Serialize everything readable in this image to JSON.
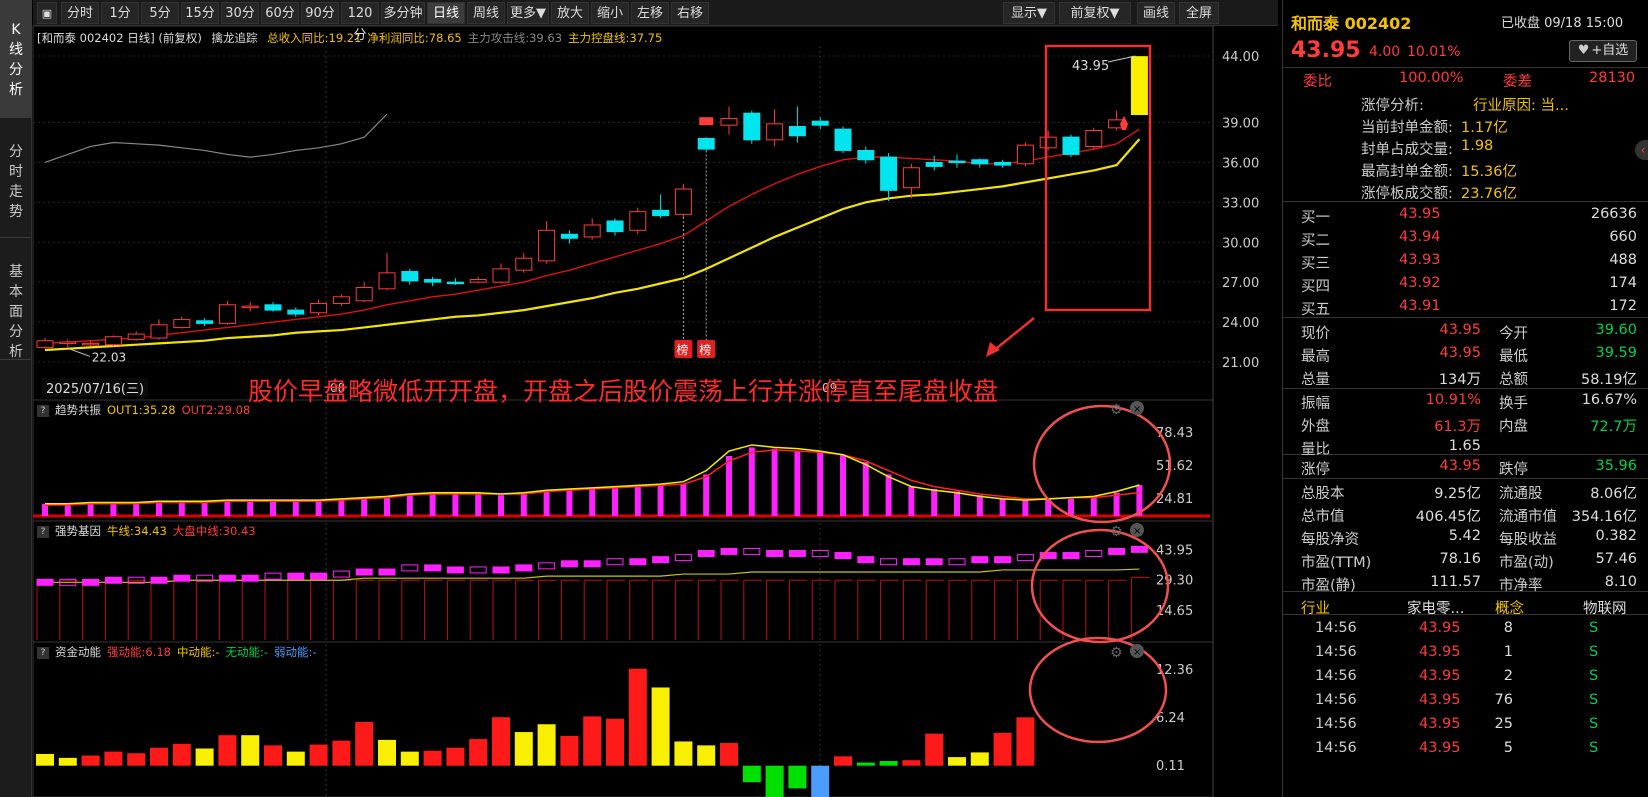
{
  "side_tabs": [
    "K线分析",
    "分时走势",
    "基本面分析"
  ],
  "toolbar": {
    "items": [
      "分时",
      "1分",
      "5分",
      "15分",
      "30分",
      "60分",
      "90分",
      "120分",
      "多分钟",
      "日线",
      "周线",
      "更多▼",
      "放大",
      "缩小",
      "左移",
      "右移"
    ],
    "right_items": [
      "显示▼",
      "前复权▼",
      "画线",
      "全屏"
    ],
    "active": "日线"
  },
  "main_chart": {
    "title": "[和而泰 002402 日线] (前复权)",
    "indicator_name": "擒龙追踪",
    "metrics": [
      {
        "text": "总收入同比:19.21",
        "color": "#f2c200"
      },
      {
        "text": "净利润同比:78.65",
        "color": "#f2c200"
      },
      {
        "text": "主力攻击线:39.63",
        "color": "#888"
      },
      {
        "text": "主力控盘线:37.75",
        "color": "#f2c200"
      }
    ],
    "y_ticks": [
      "44.00",
      "39.00",
      "36.00",
      "33.00",
      "30.00",
      "27.00",
      "24.00",
      "21.00"
    ],
    "low_label": "22.03",
    "high_label": "43.95",
    "date_label": "2025/07/16(三)",
    "month_labels": [
      "08",
      "09"
    ],
    "bang_tags": [
      "榜",
      "榜"
    ],
    "annotation": "股价早盘略微低开开盘，开盘之后股价震荡上行并涨停直至尾盘收盘"
  },
  "sub_charts": [
    {
      "name": "趋势共振",
      "fields": [
        {
          "text": "OUT1:35.28",
          "color": "#f2c200"
        },
        {
          "text": "OUT2:29.08",
          "color": "#ff3b3b"
        }
      ],
      "y_ticks": [
        "78.43",
        "51.62",
        "24.81"
      ]
    },
    {
      "name": "强势基因",
      "fields": [
        {
          "text": "牛线:34.43",
          "color": "#f2c200"
        },
        {
          "text": "大盘中线:30.43",
          "color": "#ff3b3b"
        }
      ],
      "y_ticks": [
        "43.95",
        "29.30",
        "14.65"
      ]
    },
    {
      "name": "资金动能",
      "fields": [
        {
          "text": "强动能:6.18",
          "color": "#ff3b3b"
        },
        {
          "text": "中动能:-",
          "color": "#f2c200"
        },
        {
          "text": "无动能:-",
          "color": "#00d24a"
        },
        {
          "text": "弱动能:-",
          "color": "#4a9cff"
        }
      ],
      "y_ticks": [
        "12.36",
        "6.24",
        "0.11"
      ]
    }
  ],
  "chart_data": {
    "type": "candlestick",
    "title": "和而泰 002402 日线",
    "y_range": [
      21.0,
      44.0
    ],
    "candles": [
      {
        "o": 22.1,
        "c": 22.6,
        "h": 22.8,
        "l": 22.0
      },
      {
        "o": 22.4,
        "c": 22.5,
        "h": 22.7,
        "l": 22.03
      },
      {
        "o": 22.3,
        "c": 22.4,
        "h": 22.6,
        "l": 22.2
      },
      {
        "o": 22.3,
        "c": 22.9,
        "h": 23.0,
        "l": 22.2
      },
      {
        "o": 22.7,
        "c": 23.1,
        "h": 23.3,
        "l": 22.6
      },
      {
        "o": 22.8,
        "c": 23.8,
        "h": 24.2,
        "l": 22.7
      },
      {
        "o": 23.6,
        "c": 24.2,
        "h": 24.4,
        "l": 23.5
      },
      {
        "o": 24.1,
        "c": 23.9,
        "h": 24.3,
        "l": 23.7
      },
      {
        "o": 23.9,
        "c": 25.3,
        "h": 25.6,
        "l": 23.8
      },
      {
        "o": 25.1,
        "c": 25.2,
        "h": 25.5,
        "l": 24.8
      },
      {
        "o": 25.3,
        "c": 24.9,
        "h": 25.5,
        "l": 24.8
      },
      {
        "o": 24.9,
        "c": 24.6,
        "h": 25.1,
        "l": 24.4
      },
      {
        "o": 24.7,
        "c": 25.4,
        "h": 25.7,
        "l": 24.5
      },
      {
        "o": 25.4,
        "c": 25.9,
        "h": 26.1,
        "l": 25.2
      },
      {
        "o": 25.6,
        "c": 26.6,
        "h": 27.0,
        "l": 25.5
      },
      {
        "o": 26.5,
        "c": 27.7,
        "h": 29.2,
        "l": 26.4
      },
      {
        "o": 27.8,
        "c": 27.1,
        "h": 28.0,
        "l": 26.8
      },
      {
        "o": 27.2,
        "c": 27.0,
        "h": 27.4,
        "l": 26.7
      },
      {
        "o": 27.0,
        "c": 26.9,
        "h": 27.3,
        "l": 26.8
      },
      {
        "o": 27.0,
        "c": 27.2,
        "h": 27.4,
        "l": 26.9
      },
      {
        "o": 27.0,
        "c": 28.0,
        "h": 28.4,
        "l": 26.9
      },
      {
        "o": 27.9,
        "c": 28.8,
        "h": 29.2,
        "l": 27.7
      },
      {
        "o": 28.6,
        "c": 30.9,
        "h": 31.6,
        "l": 28.4
      },
      {
        "o": 30.6,
        "c": 30.3,
        "h": 30.9,
        "l": 29.9
      },
      {
        "o": 30.4,
        "c": 31.3,
        "h": 31.8,
        "l": 30.2
      },
      {
        "o": 31.6,
        "c": 30.8,
        "h": 31.8,
        "l": 30.5
      },
      {
        "o": 30.9,
        "c": 32.3,
        "h": 32.6,
        "l": 30.6
      },
      {
        "o": 32.4,
        "c": 32.0,
        "h": 33.6,
        "l": 31.8
      },
      {
        "o": 32.1,
        "c": 34.0,
        "h": 34.4,
        "l": 31.9
      },
      {
        "o": 37.8,
        "c": 37.0,
        "h": 37.9,
        "l": 36.9
      },
      {
        "o": 38.8,
        "c": 39.3,
        "h": 40.2,
        "l": 38.1
      },
      {
        "o": 39.7,
        "c": 37.7,
        "h": 39.9,
        "l": 37.4
      },
      {
        "o": 37.7,
        "c": 38.9,
        "h": 40.0,
        "l": 37.2
      },
      {
        "o": 38.7,
        "c": 38.0,
        "h": 40.2,
        "l": 37.5
      },
      {
        "o": 39.1,
        "c": 38.8,
        "h": 39.4,
        "l": 38.5
      },
      {
        "o": 38.5,
        "c": 36.9,
        "h": 38.7,
        "l": 36.7
      },
      {
        "o": 36.9,
        "c": 36.2,
        "h": 37.2,
        "l": 35.9
      },
      {
        "o": 36.4,
        "c": 33.9,
        "h": 36.7,
        "l": 33.1
      },
      {
        "o": 34.1,
        "c": 35.6,
        "h": 35.9,
        "l": 33.3
      },
      {
        "o": 36.0,
        "c": 35.7,
        "h": 36.5,
        "l": 35.4
      },
      {
        "o": 36.1,
        "c": 36.0,
        "h": 36.6,
        "l": 35.6
      },
      {
        "o": 36.2,
        "c": 35.9,
        "h": 36.3,
        "l": 35.6
      },
      {
        "o": 36.0,
        "c": 35.8,
        "h": 36.2,
        "l": 35.6
      },
      {
        "o": 35.9,
        "c": 37.3,
        "h": 37.5,
        "l": 35.7
      },
      {
        "o": 37.1,
        "c": 37.9,
        "h": 38.4,
        "l": 36.9
      },
      {
        "o": 37.9,
        "c": 36.6,
        "h": 38.1,
        "l": 36.4
      },
      {
        "o": 37.2,
        "c": 38.4,
        "h": 38.6,
        "l": 37.0
      },
      {
        "o": 38.6,
        "c": 39.2,
        "h": 39.9,
        "l": 38.4
      },
      {
        "o": 39.6,
        "c": 43.95,
        "h": 43.95,
        "l": 39.59
      }
    ],
    "ma_gray": [
      22.5,
      22.6,
      22.7,
      22.8,
      23.0,
      23.2,
      23.4,
      23.6,
      23.9,
      24.1,
      24.3,
      24.5,
      24.7,
      24.9,
      25.2,
      25.6,
      26.0,
      26.3,
      26.5,
      26.7,
      27.0,
      27.4,
      27.9,
      28.3,
      28.8,
      29.3,
      29.8,
      30.3,
      30.9,
      32.1,
      33.4,
      34.4,
      35.3,
      36.0,
      36.6,
      37.2,
      37.5,
      37.4,
      37.3,
      37.1,
      36.9,
      36.6,
      36.4,
      36.6,
      36.9,
      37.1,
      37.4,
      37.9,
      39.63
    ],
    "ma_red": [
      22.4,
      22.5,
      22.6,
      22.7,
      22.8,
      23.0,
      23.2,
      23.4,
      23.6,
      23.8,
      24.0,
      24.2,
      24.4,
      24.6,
      24.9,
      25.3,
      25.6,
      25.9,
      26.1,
      26.4,
      26.7,
      27.0,
      27.5,
      27.9,
      28.4,
      28.9,
      29.4,
      29.9,
      30.5,
      31.6,
      32.7,
      33.6,
      34.4,
      35.1,
      35.7,
      36.2,
      36.4,
      36.4,
      36.3,
      36.2,
      36.1,
      35.9,
      35.9,
      36.1,
      36.4,
      36.7,
      37.0,
      37.4,
      38.5
    ],
    "ma_yellow": [
      21.9,
      22.0,
      22.1,
      22.2,
      22.3,
      22.4,
      22.5,
      22.6,
      22.8,
      22.9,
      23.0,
      23.2,
      23.3,
      23.4,
      23.6,
      23.8,
      24.0,
      24.2,
      24.4,
      24.5,
      24.7,
      24.9,
      25.2,
      25.5,
      25.8,
      26.2,
      26.5,
      26.9,
      27.3,
      28.0,
      28.8,
      29.6,
      30.4,
      31.1,
      31.8,
      32.5,
      33.0,
      33.3,
      33.5,
      33.6,
      33.8,
      34.0,
      34.2,
      34.5,
      34.8,
      35.1,
      35.4,
      35.8,
      37.75
    ]
  },
  "trend_data": {
    "y_range": [
      10,
      90
    ],
    "bars": [
      20,
      20,
      20,
      20,
      20,
      21,
      21,
      21,
      22,
      22,
      22,
      22,
      22,
      23,
      24,
      25,
      27,
      28,
      28,
      28,
      27,
      28,
      30,
      31,
      32,
      33,
      34,
      35,
      36,
      44,
      59,
      66,
      65,
      63,
      62,
      60,
      54,
      44,
      34,
      32,
      30,
      27,
      24,
      23,
      24,
      24,
      25,
      29,
      35.28
    ],
    "out1": [
      20,
      20,
      21,
      21,
      21,
      22,
      22,
      22,
      23,
      23,
      23,
      23,
      23,
      24,
      25,
      26,
      28,
      29,
      29,
      29,
      28,
      29,
      31,
      32,
      33,
      34,
      35,
      36,
      38,
      47,
      63,
      68,
      66,
      65,
      63,
      60,
      52,
      42,
      34,
      31,
      29,
      26,
      24,
      23,
      24,
      25,
      26,
      30,
      35.28
    ],
    "out2": [
      19,
      19,
      20,
      20,
      20,
      21,
      21,
      21,
      22,
      22,
      22,
      22,
      22,
      23,
      24,
      25,
      27,
      28,
      28,
      28,
      28,
      28,
      30,
      31,
      32,
      33,
      34,
      35,
      36,
      42,
      55,
      62,
      64,
      63,
      62,
      60,
      55,
      47,
      39,
      34,
      31,
      28,
      26,
      24,
      24,
      25,
      25,
      27,
      29.08
    ]
  },
  "strong_data": {
    "y_range": [
      0,
      50
    ],
    "stems": [
      29,
      29,
      29,
      29,
      29,
      29,
      29,
      29,
      29,
      29,
      29,
      29,
      29,
      29,
      29,
      29,
      29,
      29,
      29,
      29,
      29,
      29,
      29,
      29,
      29,
      29,
      29,
      29,
      29,
      29,
      29,
      29,
      29,
      29,
      29,
      29,
      29,
      29,
      29,
      29,
      29,
      29,
      29,
      29,
      29,
      29,
      29,
      29,
      30.43
    ],
    "blocks": [
      28,
      28,
      28,
      29,
      29,
      29,
      30,
      30,
      30,
      30,
      31,
      31,
      31,
      32,
      33,
      33,
      35,
      35,
      34,
      34,
      34,
      35,
      36,
      37,
      37,
      38,
      38,
      39,
      40,
      42,
      43,
      43,
      42,
      42,
      42,
      41,
      39,
      38,
      38,
      38,
      38,
      39,
      39,
      40,
      41,
      41,
      42,
      43,
      44
    ],
    "bull": [
      28,
      28,
      28,
      28,
      28,
      28,
      29,
      29,
      29,
      29,
      29,
      29,
      29,
      29,
      30,
      30,
      30,
      30,
      30,
      30,
      30,
      30,
      31,
      31,
      31,
      31,
      31,
      31,
      32,
      32,
      32,
      33,
      33,
      33,
      33,
      33,
      33,
      33,
      33,
      33,
      33,
      33,
      34,
      34,
      34,
      34,
      34,
      34,
      34.43
    ]
  },
  "money_data": {
    "y_range": [
      -4,
      13
    ],
    "bars": [
      1.5,
      1.0,
      1.3,
      1.8,
      1.6,
      2.3,
      2.8,
      2.2,
      3.9,
      3.9,
      2.6,
      1.8,
      2.7,
      3.2,
      5.6,
      3.3,
      1.8,
      1.9,
      2.3,
      3.4,
      6.2,
      4.3,
      5.3,
      3.8,
      6.3,
      6.0,
      12.4,
      10.0,
      3.1,
      2.6,
      2.9,
      -2.1,
      -4.0,
      -2.9,
      -4.4,
      1.2,
      0.4,
      0.6,
      0.7,
      4.1,
      1.1,
      1.7,
      4.2,
      6.18
    ],
    "colors": [
      "y",
      "y",
      "r",
      "r",
      "r",
      "r",
      "r",
      "y",
      "r",
      "y",
      "r",
      "y",
      "r",
      "r",
      "r",
      "y",
      "y",
      "r",
      "r",
      "r",
      "r",
      "y",
      "y",
      "r",
      "r",
      "r",
      "r",
      "y",
      "y",
      "y",
      "r",
      "g",
      "g",
      "g",
      "b",
      "r",
      "g",
      "g",
      "r",
      "r",
      "y",
      "y",
      "r",
      "r"
    ]
  },
  "right_panel": {
    "name": "和而泰 002402",
    "status": "已收盘 09/18 15:00",
    "price": "43.95",
    "change": "4.00",
    "pct": "10.01%",
    "add_btn": "+自选",
    "weibi_label": "委比",
    "weibi_val": "100.00%",
    "weicha_label": "委差",
    "weicha_val": "28130",
    "limit_analysis": [
      {
        "label": "涨停分析:",
        "val": "行业原因: 当..."
      },
      {
        "label": "当前封单金额:",
        "val": "1.17亿"
      },
      {
        "label": "封单占成交量:",
        "val": "1.98"
      },
      {
        "label": "最高封单金额:",
        "val": "15.36亿"
      },
      {
        "label": "涨停板成交额:",
        "val": "23.76亿"
      }
    ],
    "bids": [
      {
        "label": "买一",
        "price": "43.95",
        "vol": "26636"
      },
      {
        "label": "买二",
        "price": "43.94",
        "vol": "660"
      },
      {
        "label": "买三",
        "price": "43.93",
        "vol": "488"
      },
      {
        "label": "买四",
        "price": "43.92",
        "vol": "174"
      },
      {
        "label": "买五",
        "price": "43.91",
        "vol": "172"
      }
    ],
    "stats1": [
      {
        "l1": "现价",
        "v1": "43.95",
        "c1": "r",
        "l2": "今开",
        "v2": "39.60",
        "c2": "g"
      },
      {
        "l1": "最高",
        "v1": "43.95",
        "c1": "r",
        "l2": "最低",
        "v2": "39.59",
        "c2": "g"
      },
      {
        "l1": "总量",
        "v1": "134万",
        "c1": "w",
        "l2": "总额",
        "v2": "58.19亿",
        "c2": "w"
      }
    ],
    "stats2": [
      {
        "l1": "振幅",
        "v1": "10.91%",
        "c1": "r",
        "l2": "换手",
        "v2": "16.67%",
        "c2": "w"
      },
      {
        "l1": "外盘",
        "v1": "61.3万",
        "c1": "r",
        "l2": "内盘",
        "v2": "72.7万",
        "c2": "g"
      },
      {
        "l1": "量比",
        "v1": "1.65",
        "c1": "w",
        "l2": "",
        "v2": "",
        "c2": "w"
      }
    ],
    "stats3": [
      {
        "l1": "涨停",
        "v1": "43.95",
        "c1": "r",
        "l2": "跌停",
        "v2": "35.96",
        "c2": "g"
      }
    ],
    "stats4": [
      {
        "l1": "总股本",
        "v1": "9.25亿",
        "c1": "w",
        "l2": "流通股",
        "v2": "8.06亿",
        "c2": "w"
      },
      {
        "l1": "总市值",
        "v1": "406.45亿",
        "c1": "w",
        "l2": "流通市值",
        "v2": "354.16亿",
        "c2": "w"
      },
      {
        "l1": "每股净资",
        "v1": "5.42",
        "c1": "w",
        "l2": "每股收益",
        "v2": "0.382",
        "c2": "w"
      },
      {
        "l1": "市盈(TTM)",
        "v1": "78.16",
        "c1": "w",
        "l2": "市盈(动)",
        "v2": "57.46",
        "c2": "w"
      },
      {
        "l1": "市盈(静)",
        "v1": "111.57",
        "c1": "w",
        "l2": "市净率",
        "v2": "8.10",
        "c2": "w"
      }
    ],
    "industry_label": "行业",
    "industry_val": "家电零...",
    "concept_label": "概念",
    "concept_val": "物联网",
    "ticks": [
      {
        "t": "14:56",
        "p": "43.95",
        "v": "8",
        "s": "S"
      },
      {
        "t": "14:56",
        "p": "43.95",
        "v": "1",
        "s": "S"
      },
      {
        "t": "14:56",
        "p": "43.95",
        "v": "2",
        "s": "S"
      },
      {
        "t": "14:56",
        "p": "43.95",
        "v": "76",
        "s": "S"
      },
      {
        "t": "14:56",
        "p": "43.95",
        "v": "25",
        "s": "S"
      },
      {
        "t": "14:56",
        "p": "43.95",
        "v": "5",
        "s": "S"
      }
    ]
  }
}
